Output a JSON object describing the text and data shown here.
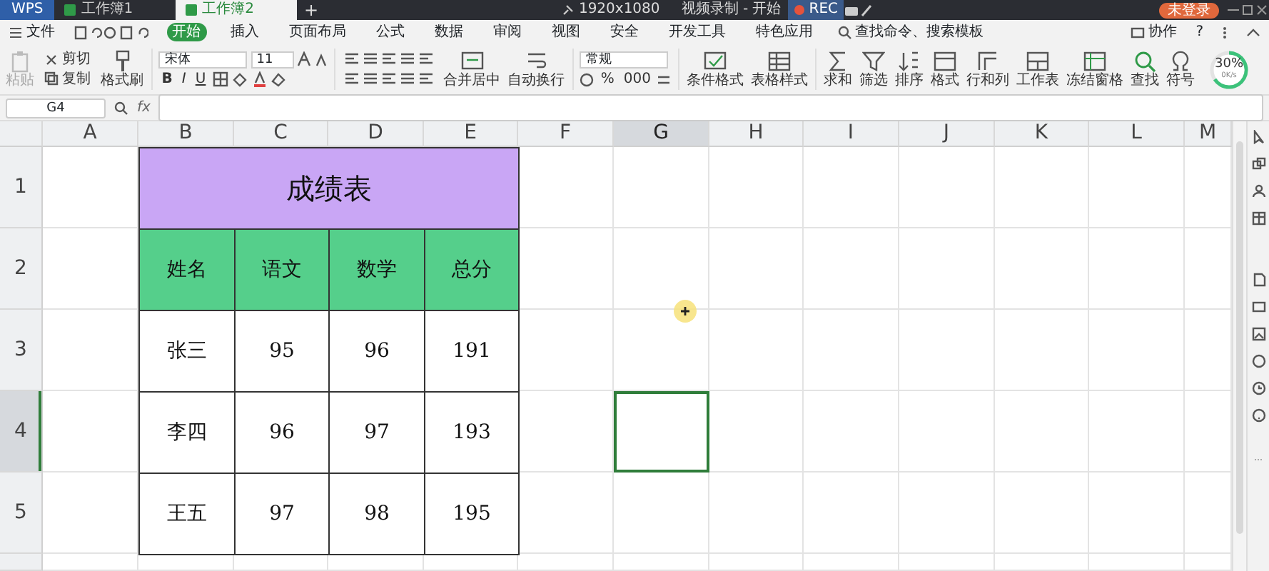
{
  "title_bar": {
    "app_tab": "WPS",
    "tabs": [
      {
        "label": "工作簿1",
        "selected": false
      },
      {
        "label": "工作簿2",
        "selected": true
      }
    ],
    "add_tab": "+",
    "resolution": "1920x1080",
    "recorder": "视频录制 - 开始",
    "rec": "REC",
    "account": "未登录"
  },
  "menu": {
    "file": "文件",
    "items": [
      {
        "label": "开始",
        "selected": true
      },
      {
        "label": "插入",
        "selected": false
      },
      {
        "label": "页面布局",
        "selected": false
      },
      {
        "label": "公式",
        "selected": false
      },
      {
        "label": "数据",
        "selected": false
      },
      {
        "label": "审阅",
        "selected": false
      },
      {
        "label": "视图",
        "selected": false
      },
      {
        "label": "安全",
        "selected": false
      },
      {
        "label": "开发工具",
        "selected": false
      },
      {
        "label": "特色应用",
        "selected": false
      }
    ],
    "search": "查找命令、搜索模板",
    "right": "协作",
    "help": "?"
  },
  "ribbon": {
    "paste": {
      "label": "粘贴",
      "disabled": true
    },
    "cut": "剪切",
    "copy": "复制",
    "format_painter": "格式刷",
    "font": "宋体",
    "font_size": "11",
    "style_buttons": [
      "B",
      "I",
      "U"
    ],
    "merge": "合并居中",
    "wrap": "自动换行",
    "number_format": "常规",
    "number_buttons": [
      "%",
      "000"
    ],
    "tools": [
      "条件格式",
      "表格样式",
      "求和",
      "筛选",
      "排序",
      "格式",
      "行和列",
      "工作表",
      "冻结窗格",
      "查找",
      "符号"
    ],
    "speed": {
      "percent": "30%",
      "rate": "0K/s"
    }
  },
  "formula_bar": {
    "name_box": "G4",
    "fx": "fx"
  },
  "sheet": {
    "columns": [
      {
        "label": "A",
        "selected": false
      },
      {
        "label": "B",
        "selected": false
      },
      {
        "label": "C",
        "selected": false
      },
      {
        "label": "D",
        "selected": false
      },
      {
        "label": "E",
        "selected": false
      },
      {
        "label": "F",
        "selected": false
      },
      {
        "label": "G",
        "selected": true
      },
      {
        "label": "H",
        "selected": false
      },
      {
        "label": "I",
        "selected": false
      },
      {
        "label": "J",
        "selected": false
      },
      {
        "label": "K",
        "selected": false
      },
      {
        "label": "L",
        "selected": false
      },
      {
        "label": "M",
        "selected": false
      }
    ],
    "rows": [
      {
        "label": "1",
        "selected": false
      },
      {
        "label": "2",
        "selected": false
      },
      {
        "label": "3",
        "selected": false
      },
      {
        "label": "4",
        "selected": true
      },
      {
        "label": "5",
        "selected": false
      }
    ],
    "table": {
      "title": "成绩表",
      "headers": [
        "姓名",
        "语文",
        "数学",
        "总分"
      ],
      "rows": [
        [
          "张三",
          "95",
          "96",
          "191"
        ],
        [
          "李四",
          "96",
          "97",
          "193"
        ],
        [
          "王五",
          "97",
          "98",
          "195"
        ]
      ]
    }
  }
}
